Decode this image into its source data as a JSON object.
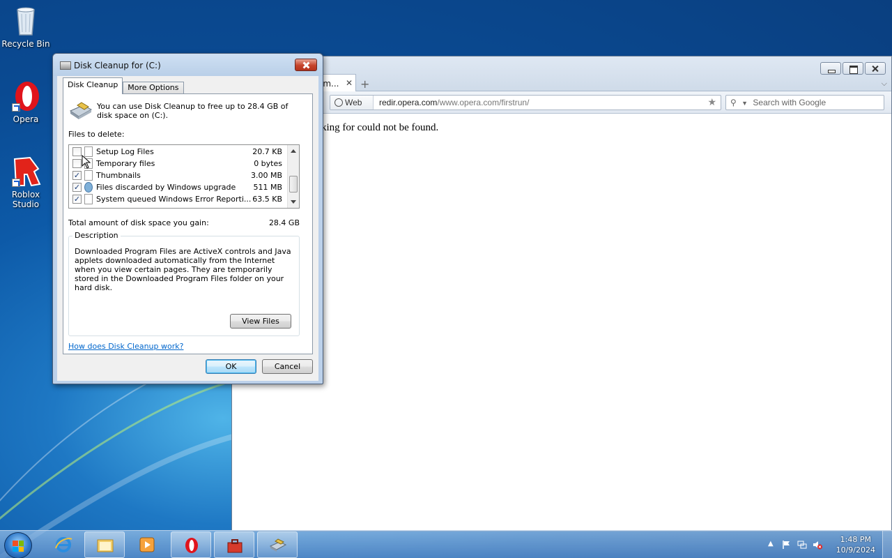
{
  "desktop": {
    "icons": [
      {
        "label": "Recycle Bin",
        "icon": "recycle-bin-icon"
      },
      {
        "label": "Opera",
        "icon": "opera-icon"
      },
      {
        "label": "Roblox Studio",
        "icon": "roblox-studio-icon"
      }
    ]
  },
  "browser": {
    "tab_title": "om...",
    "tab_close": "✕",
    "new_tab": "+",
    "web_badge": "Web",
    "url_domain": "redir.opera.com",
    "url_path": "/www.opera.com/firstrun/",
    "url_prefix": "",
    "search_placeholder": "Search with Google",
    "page_message": "king for could not be found."
  },
  "dialog": {
    "title": "Disk Cleanup for  (C:)",
    "tabs": [
      "Disk Cleanup",
      "More Options"
    ],
    "intro": "You can use Disk Cleanup to free up to 28.4 GB of disk space on  (C:).",
    "files_label": "Files to delete:",
    "files": [
      {
        "name": "Setup Log Files",
        "size": "20.7 KB",
        "checked": false
      },
      {
        "name": "Temporary files",
        "size": "0 bytes",
        "checked": false
      },
      {
        "name": "Thumbnails",
        "size": "3.00 MB",
        "checked": true
      },
      {
        "name": "Files discarded by Windows upgrade",
        "size": "511 MB",
        "checked": true
      },
      {
        "name": "System queued Windows Error Reporti...",
        "size": "63.5 KB",
        "checked": true
      }
    ],
    "check_mark": "✓",
    "total_label": "Total amount of disk space you gain:",
    "total_value": "28.4 GB",
    "description_legend": "Description",
    "description_text": "Downloaded Program Files are ActiveX controls and Java applets downloaded automatically from the Internet when you view certain pages. They are temporarily stored in the Downloaded Program Files folder on your hard disk.",
    "view_files": "View Files",
    "help_link": "How does Disk Cleanup work?",
    "ok": "OK",
    "cancel": "Cancel"
  },
  "taskbar": {
    "items": [
      "internet-explorer-icon",
      "windows-explorer-icon",
      "media-player-icon",
      "opera-icon",
      "toolbox-icon",
      "disk-cleanup-icon"
    ],
    "time": "1:48 PM",
    "date": "10/9/2024"
  },
  "colors": {
    "desktop_blue": "#0a4a92",
    "link": "#0066cc",
    "close_red": "#c6442b"
  }
}
